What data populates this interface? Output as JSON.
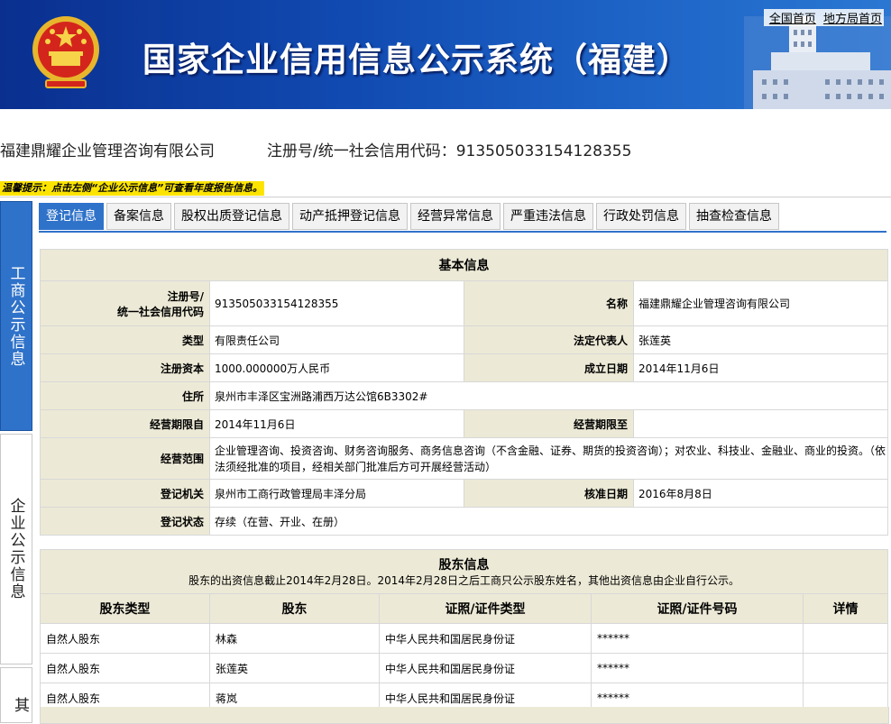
{
  "header": {
    "title": "国家企业信用信息公示系统（福建）",
    "links": [
      "全国首页",
      "地方局首页"
    ]
  },
  "company": {
    "name": "福建鼎耀企业管理咨询有限公司",
    "reg_label": "注册号/统一社会信用代码：",
    "reg_code": "913505033154128355"
  },
  "tip": "温馨提示：点击左侧“企业公示信息”可查看年度报告信息。",
  "sidebar": {
    "items": [
      {
        "label": "工商公示信息"
      },
      {
        "label": "企业公示信息"
      },
      {
        "label": "其"
      }
    ]
  },
  "tabs": [
    "登记信息",
    "备案信息",
    "股权出质登记信息",
    "动产抵押登记信息",
    "经营异常信息",
    "严重违法信息",
    "行政处罚信息",
    "抽查检查信息"
  ],
  "basic": {
    "title": "基本信息",
    "reg_no_label_1": "注册号/",
    "reg_no_label_2": "统一社会信用代码",
    "reg_no": "913505033154128355",
    "name_label": "名称",
    "name": "福建鼎耀企业管理咨询有限公司",
    "type_label": "类型",
    "type": "有限责任公司",
    "legal_label": "法定代表人",
    "legal": "张莲英",
    "capital_label": "注册资本",
    "capital": "1000.000000万人民币",
    "est_label": "成立日期",
    "est": "2014年11月6日",
    "address_label": "住所",
    "address": "泉州市丰泽区宝洲路浦西万达公馆6B3302#",
    "term_from_label": "经营期限自",
    "term_from": "2014年11月6日",
    "term_to_label": "经营期限至",
    "term_to": "",
    "scope_label": "经营范围",
    "scope": "企业管理咨询、投资咨询、财务咨询服务、商务信息咨询（不含金融、证券、期货的投资咨询）；对农业、科技业、金融业、商业的投资。（依法须经批准的项目，经相关部门批准后方可开展经营活动）",
    "authority_label": "登记机关",
    "authority": "泉州市工商行政管理局丰泽分局",
    "approval_label": "核准日期",
    "approval": "2016年8月8日",
    "status_label": "登记状态",
    "status": "存续（在营、开业、在册）"
  },
  "shareholders": {
    "title": "股东信息",
    "note": "股东的出资信息截止2014年2月28日。2014年2月28日之后工商只公示股东姓名，其他出资信息由企业自行公示。",
    "columns": [
      "股东类型",
      "股东",
      "证照/证件类型",
      "证照/证件号码",
      "详情"
    ],
    "rows": [
      [
        "自然人股东",
        "林森",
        "中华人民共和国居民身份证",
        "******",
        ""
      ],
      [
        "自然人股东",
        "张莲英",
        "中华人民共和国居民身份证",
        "******",
        ""
      ],
      [
        "自然人股东",
        "蒋岚",
        "中华人民共和国居民身份证",
        "******",
        ""
      ]
    ]
  }
}
